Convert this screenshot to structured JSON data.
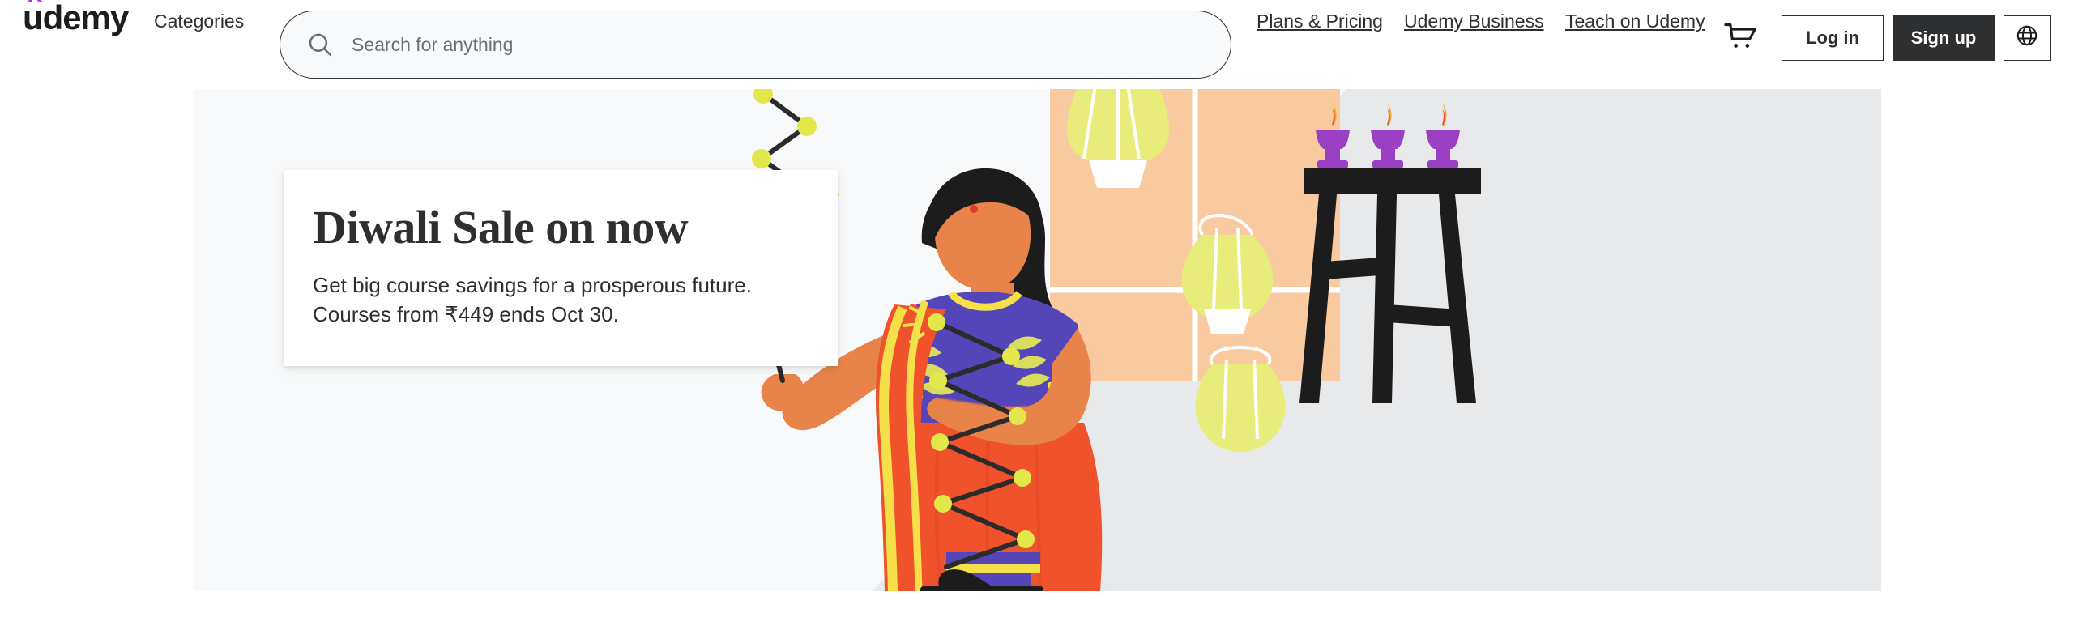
{
  "header": {
    "logo_text": "udemy",
    "logo_accent_color": "#a435f0",
    "categories_label": "Categories",
    "search": {
      "placeholder": "Search for anything",
      "value": "",
      "icon": "search-icon"
    },
    "nav_links": [
      {
        "label": "Plans & Pricing"
      },
      {
        "label": "Udemy Business"
      },
      {
        "label": "Teach on Udemy"
      }
    ],
    "cart_icon": "shopping-cart-icon",
    "login_label": "Log in",
    "signup_label": "Sign up",
    "language_icon": "globe-icon",
    "text_color": "#2d2f31"
  },
  "hero": {
    "title": "Diwali Sale on now",
    "subtitle_line1": "Get big course savings for a prosperous future.",
    "subtitle_line2": "Courses from ₹449 ends Oct 30.",
    "background_color": "#f7f9fa",
    "diagonal_color": "#e7e9eb",
    "card_background": "#ffffff",
    "illustration": {
      "name": "diwali-woman-string-lights-illustration",
      "colors": {
        "skin": "#e8834a",
        "hair": "#1c1c1c",
        "saree": "#f0522b",
        "blouse": "#5446b8",
        "trim_yellow": "#f5e04a",
        "window": "#f9c9a0",
        "lantern": "#e8ec7a",
        "diya": "#9b3fc4",
        "flame": "#f5a623",
        "stool": "#1c1c1c"
      }
    }
  }
}
